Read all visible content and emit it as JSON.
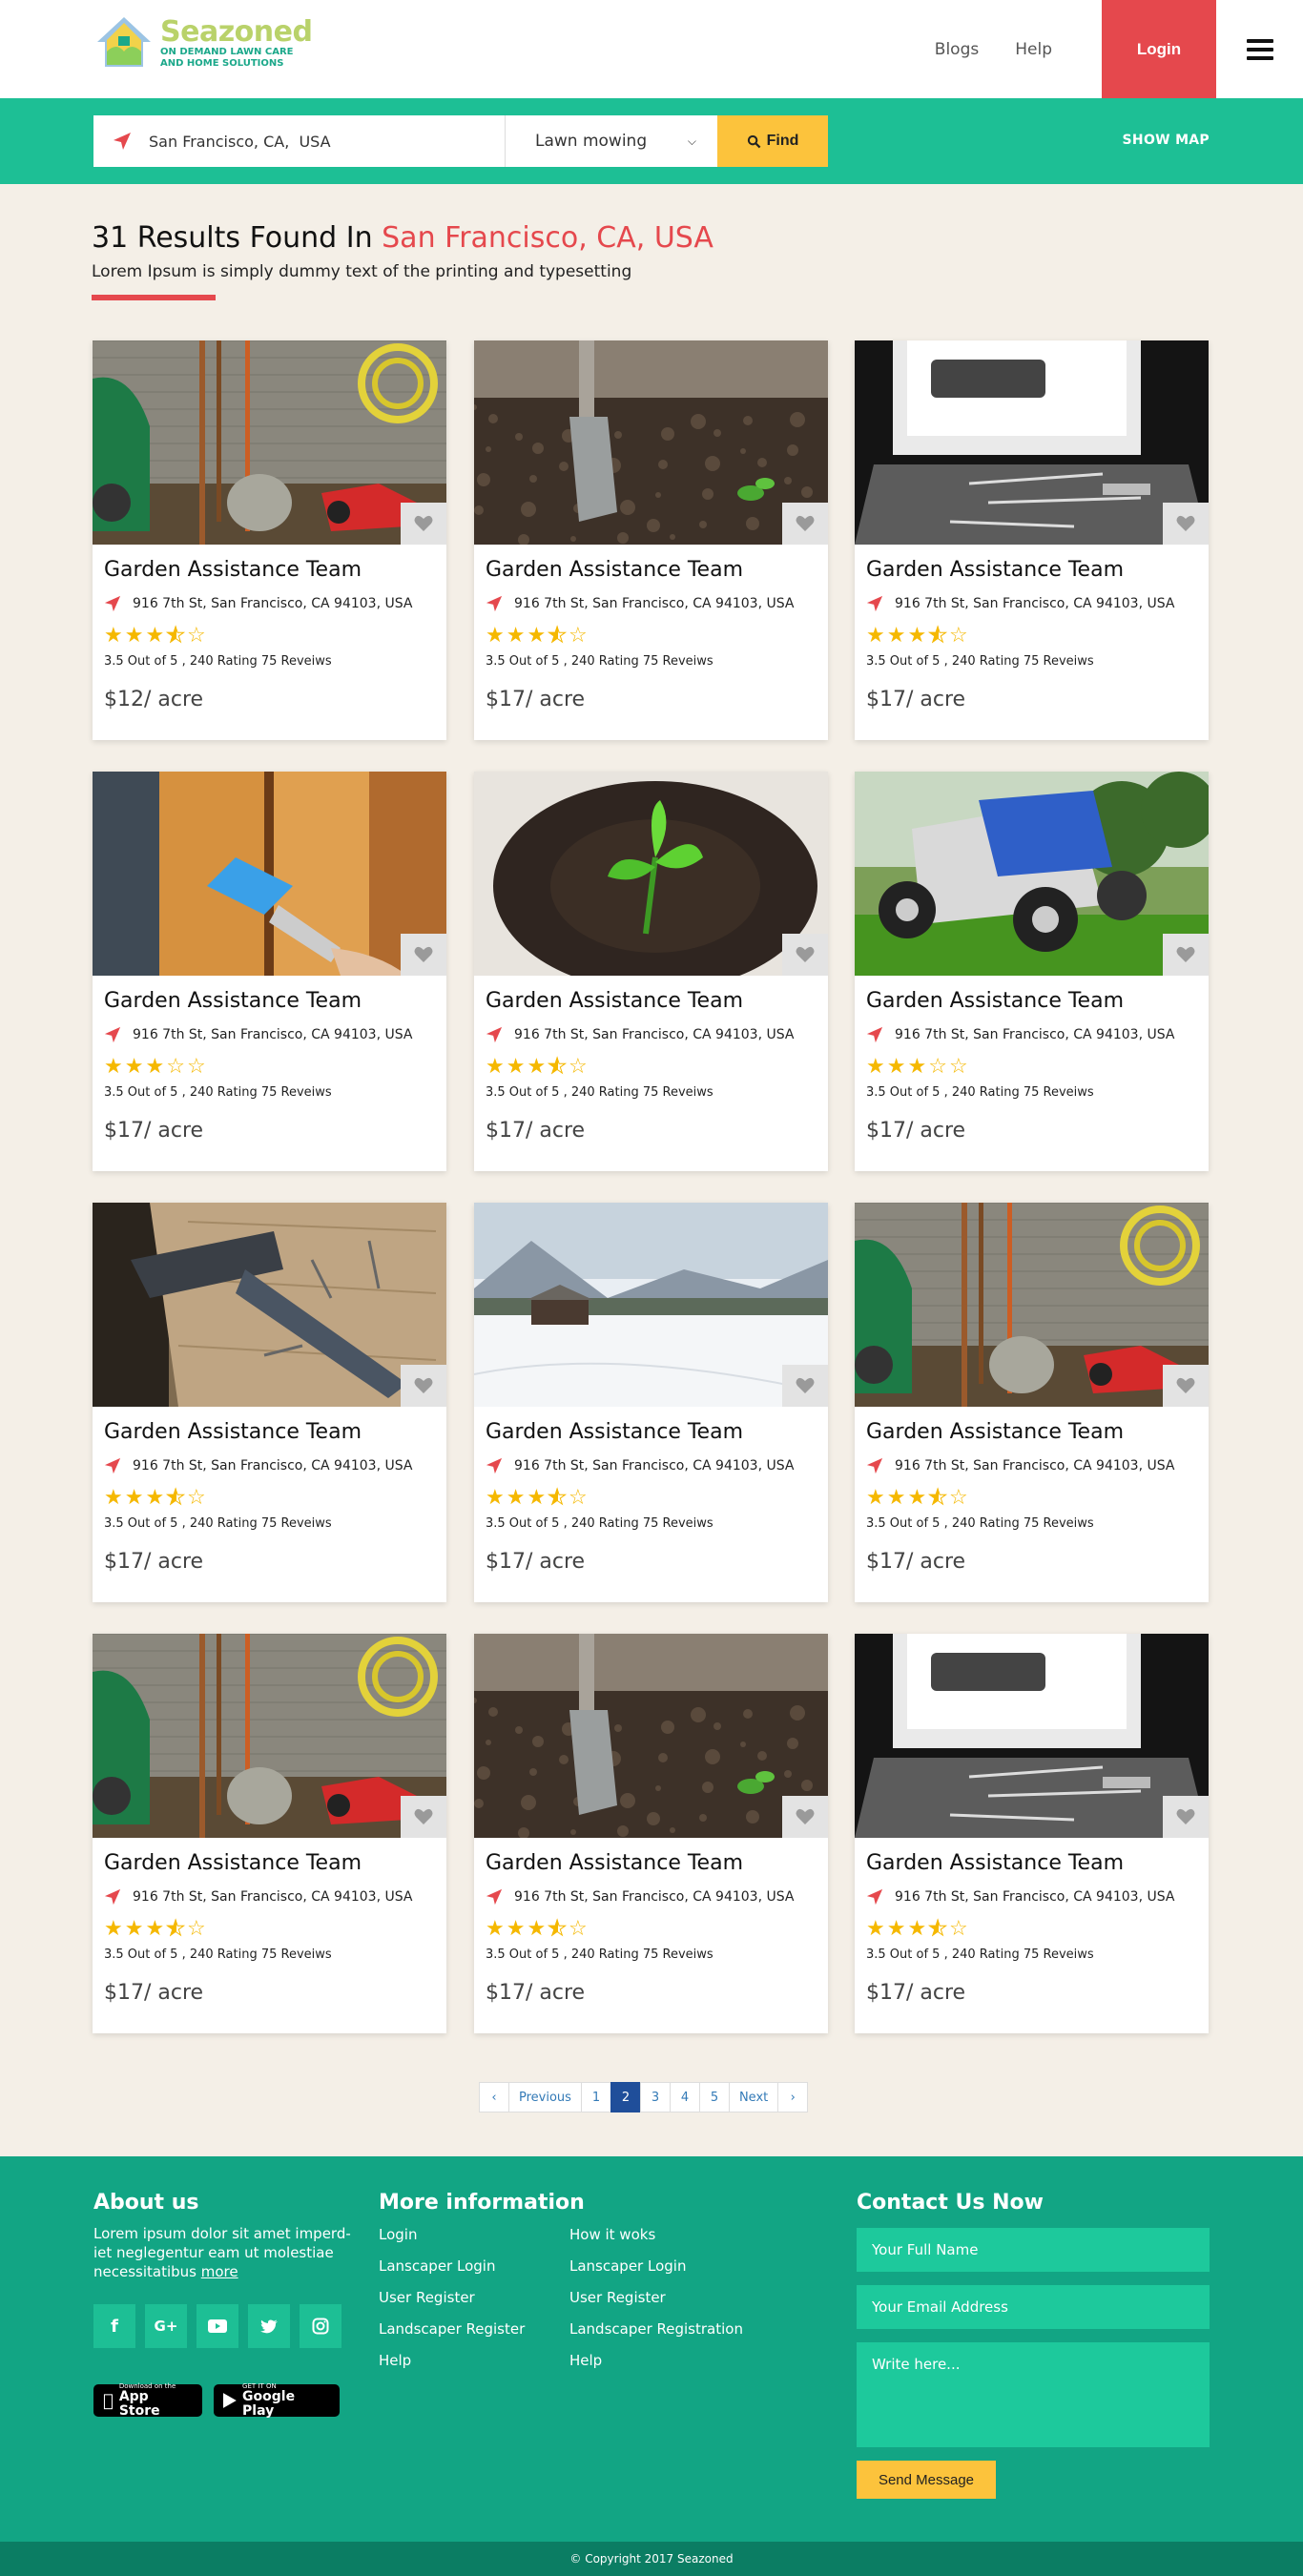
{
  "brand": {
    "name": "Seazoned",
    "tagline_line1": "ON DEMAND LAWN CARE",
    "tagline_line2": "AND HOME SOLUTIONS",
    "accent": "#1dbf95",
    "red": "#e5484d",
    "yellow": "#fcc33c"
  },
  "nav": {
    "links": [
      "Blogs",
      "Help"
    ],
    "login": "Login",
    "menu_icon": "hamburger-icon"
  },
  "search": {
    "location_value": "San Francisco, CA,  USA",
    "service_value": "Lawn mowing",
    "find_label": "Find",
    "show_map": "SHOW MAP"
  },
  "results": {
    "title_prefix": "31 Results Found In",
    "city": "San Francisco, CA,  USA",
    "subtitle": "Lorem Ipsum is simply dummy text of the printing and typesetting"
  },
  "cards": [
    {
      "image": "garden-tools",
      "title": "Garden Assistance Team",
      "address": "916 7th St, San Francisco, CA 94103, USA",
      "rating": 3.5,
      "rating_text": "3.5 Out of 5 , 240 Rating 75 Reveiws",
      "price": "$12/ acre"
    },
    {
      "image": "shovel-soil",
      "title": "Garden Assistance Team",
      "address": "916 7th St, San Francisco, CA 94103, USA",
      "rating": 3.5,
      "rating_text": "3.5 Out of 5 , 240 Rating 75 Reveiws",
      "price": "$17/ acre"
    },
    {
      "image": "window-tools",
      "title": "Garden Assistance Team",
      "address": "916 7th St, San Francisco, CA 94103, USA",
      "rating": 3.5,
      "rating_text": "3.5 Out of 5 , 240 Rating 75 Reveiws",
      "price": "$17/ acre"
    },
    {
      "image": "paint-brush",
      "title": "Garden Assistance Team",
      "address": "916 7th St, San Francisco, CA 94103, USA",
      "rating": 3,
      "rating_text": "3.5 Out of 5 , 240 Rating 75 Reveiws",
      "price": "$17/ acre"
    },
    {
      "image": "seedling",
      "title": "Garden Assistance Team",
      "address": "916 7th St, San Francisco, CA 94103, USA",
      "rating": 3.5,
      "rating_text": "3.5 Out of 5 , 240 Rating 75 Reveiws",
      "price": "$17/ acre"
    },
    {
      "image": "lawn-mower",
      "title": "Garden Assistance Team",
      "address": "916 7th St, San Francisco, CA 94103, USA",
      "rating": 3,
      "rating_text": "3.5 Out of 5 , 240 Rating 75 Reveiws",
      "price": "$17/ acre"
    },
    {
      "image": "hammer-nails",
      "title": "Garden Assistance Team",
      "address": "916 7th St, San Francisco, CA 94103, USA",
      "rating": 3.5,
      "rating_text": "3.5 Out of 5 , 240 Rating 75 Reveiws",
      "price": "$17/ acre"
    },
    {
      "image": "snow-landscape",
      "title": "Garden Assistance Team",
      "address": "916 7th St, San Francisco, CA 94103, USA",
      "rating": 3.5,
      "rating_text": "3.5 Out of 5 , 240 Rating 75 Reveiws",
      "price": "$17/ acre"
    },
    {
      "image": "garden-tools",
      "title": "Garden Assistance Team",
      "address": "916 7th St, San Francisco, CA 94103, USA",
      "rating": 3.5,
      "rating_text": "3.5 Out of 5 , 240 Rating 75 Reveiws",
      "price": "$17/ acre"
    },
    {
      "image": "garden-tools",
      "title": "Garden Assistance Team",
      "address": "916 7th St, San Francisco, CA 94103, USA",
      "rating": 3.5,
      "rating_text": "3.5 Out of 5 , 240 Rating 75 Reveiws",
      "price": "$17/ acre"
    },
    {
      "image": "shovel-soil",
      "title": "Garden Assistance Team",
      "address": "916 7th St, San Francisco, CA 94103, USA",
      "rating": 3.5,
      "rating_text": "3.5 Out of 5 , 240 Rating 75 Reveiws",
      "price": "$17/ acre"
    },
    {
      "image": "window-tools",
      "title": "Garden Assistance Team",
      "address": "916 7th St, San Francisco, CA 94103, USA",
      "rating": 3.5,
      "rating_text": "3.5 Out of 5 , 240 Rating 75 Reveiws",
      "price": "$17/ acre"
    }
  ],
  "pagination": {
    "prev": "Previous",
    "pages": [
      "1",
      "2",
      "3",
      "4",
      "5"
    ],
    "active": "2",
    "next": "Next"
  },
  "footer": {
    "about_title": "About us",
    "about_text": "Lorem ipsum dolor sit amet imperd- iet neglegentur eam ut molestiae necessitatibus",
    "about_more": "more",
    "socials": [
      "facebook-icon",
      "google-plus-icon",
      "youtube-icon",
      "twitter-icon",
      "instagram-icon"
    ],
    "app_store_small": "Download on the",
    "app_store": "App Store",
    "play_small": "GET IT ON",
    "play": "Google Play",
    "more_title": "More information",
    "col1": [
      "Login",
      "Lanscaper Login",
      "User Register",
      "Landscaper Register",
      "Help"
    ],
    "col2": [
      "How it woks",
      "Lanscaper Login",
      "User Register",
      "Landscaper Registration",
      "Help"
    ],
    "contact_title": "Contact Us Now",
    "name_placeholder": "Your Full Name",
    "email_placeholder": "Your Email Address",
    "message_placeholder": "Write here...",
    "send": "Send Message",
    "copyright": "© Copyright 2017 Seazoned"
  }
}
